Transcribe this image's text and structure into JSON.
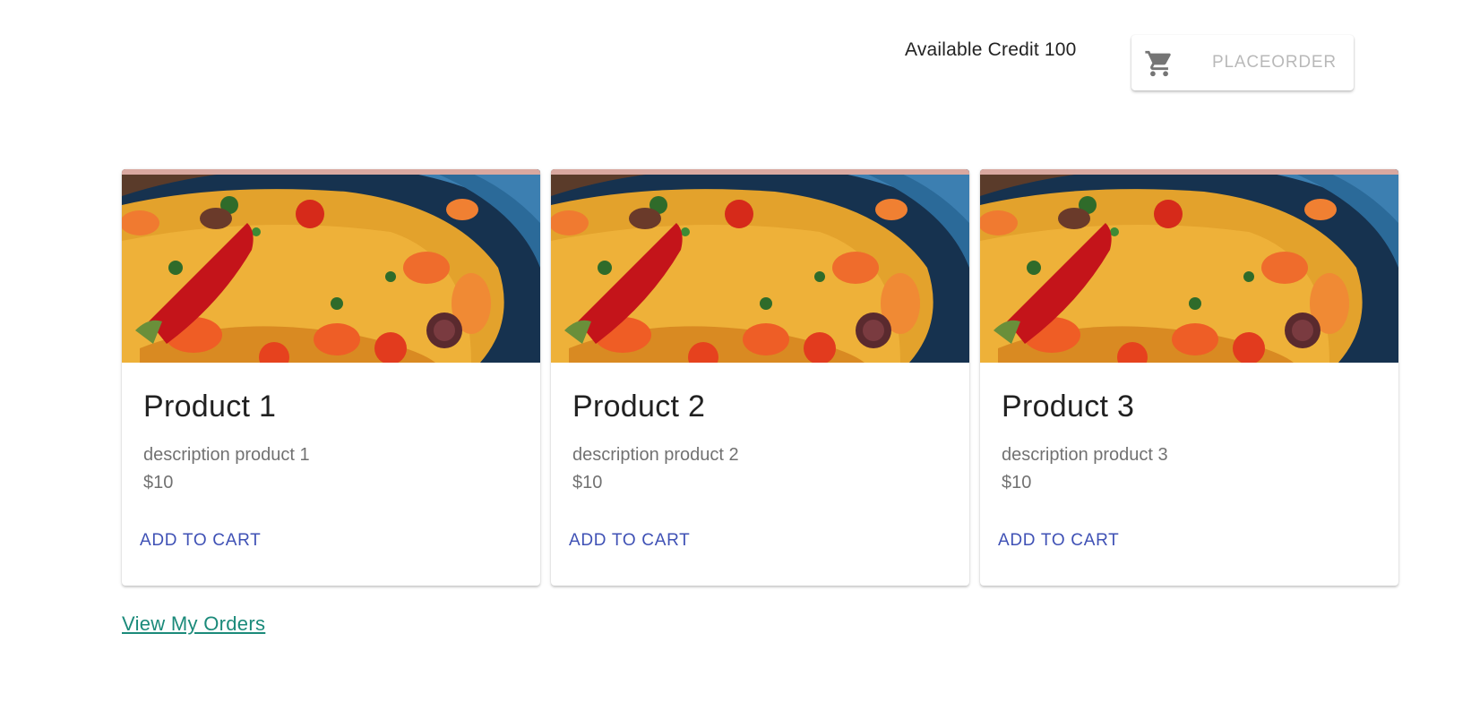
{
  "header": {
    "credit_text": "Available Credit 100",
    "place_order_label": "PLACEORDER",
    "cart_icon": "shopping-cart-icon"
  },
  "products": [
    {
      "title": "Product 1",
      "description": "description product 1",
      "price": "$10",
      "action": "ADD TO CART"
    },
    {
      "title": "Product 2",
      "description": "description product 2",
      "price": "$10",
      "action": "ADD TO CART"
    },
    {
      "title": "Product 3",
      "description": "description product 3",
      "price": "$10",
      "action": "ADD TO CART"
    }
  ],
  "footer": {
    "view_orders_link": "View My Orders"
  },
  "colors": {
    "accent": "#3f51b5",
    "link": "#1b8a7a",
    "disabled_text": "#b8b8b8"
  }
}
